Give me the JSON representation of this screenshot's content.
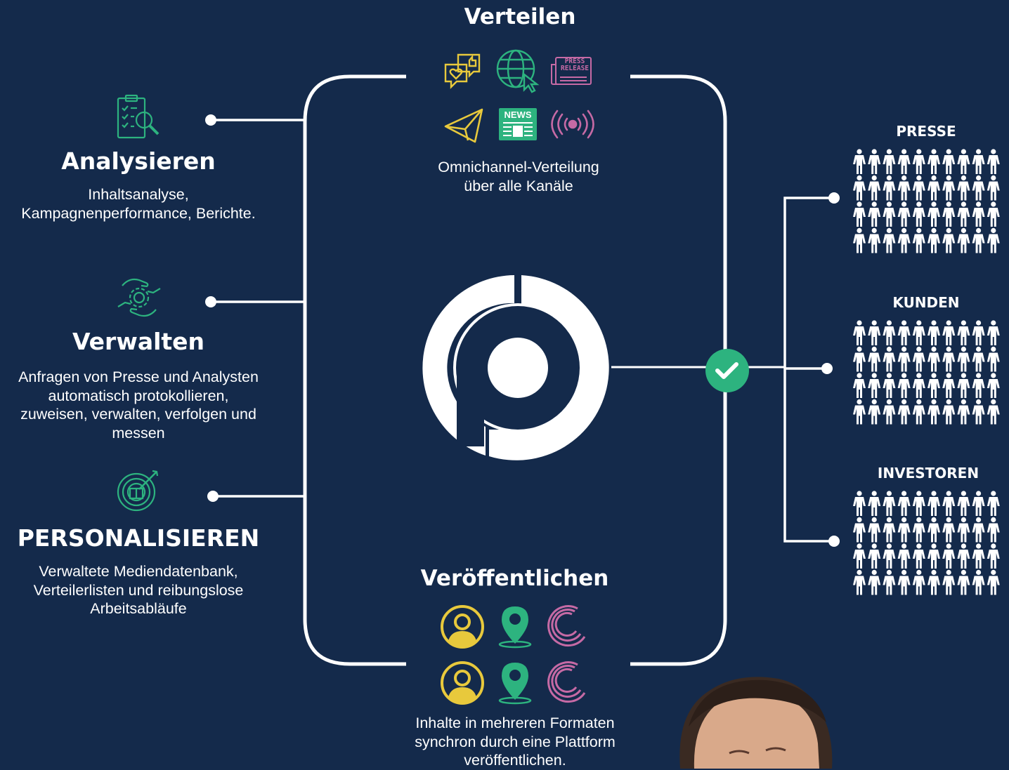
{
  "colors": {
    "background": "#142a4b",
    "green": "#2db37f",
    "yellow": "#e8c93c",
    "pink": "#c66aa5",
    "white": "#ffffff"
  },
  "left": [
    {
      "title": "Analysieren",
      "description_lines": [
        "Inhaltsanalyse,",
        "Kampagnenperformance, Berichte."
      ],
      "icon": "clipboard-search-icon"
    },
    {
      "title": "Verwalten",
      "description_lines": [
        "Anfragen von Presse und Analysten",
        "automatisch protokollieren,",
        "zuweisen, verwalten, verfolgen und",
        "messen"
      ],
      "icon": "hands-gear-icon"
    },
    {
      "title": "PERSONALISIEREN",
      "description_lines": [
        "Verwaltete Mediendatenbank,",
        "Verteilerlisten und reibungslose",
        "Arbeitsabläufe"
      ],
      "icon": "target-book-icon"
    }
  ],
  "top": {
    "title": "Verteilen",
    "description_lines": [
      "Omnichannel-Verteilung",
      "über alle Kanäle"
    ],
    "icons": [
      "chat-heart-icon",
      "globe-cursor-icon",
      "press-release-icon",
      "paper-plane-icon",
      "news-icon",
      "broadcast-icon"
    ],
    "press_label": "PRESS RELEASE",
    "news_label": "NEWS"
  },
  "bottom": {
    "title": "Veröffentlichen",
    "description_lines": [
      "Inhalte in mehreren Formaten",
      "synchron durch eine Plattform",
      "veröffentlichen."
    ],
    "icons": [
      "user-circle-icon",
      "location-pin-icon",
      "crescent-icon",
      "user-circle-icon",
      "location-pin-icon",
      "crescent-icon"
    ]
  },
  "center_logo": "p-logo",
  "check_icon": "check-circle-icon",
  "audiences": [
    {
      "label": "PRESSE"
    },
    {
      "label": "KUNDEN"
    },
    {
      "label": "INVESTOREN"
    }
  ],
  "photo": "person-photo"
}
